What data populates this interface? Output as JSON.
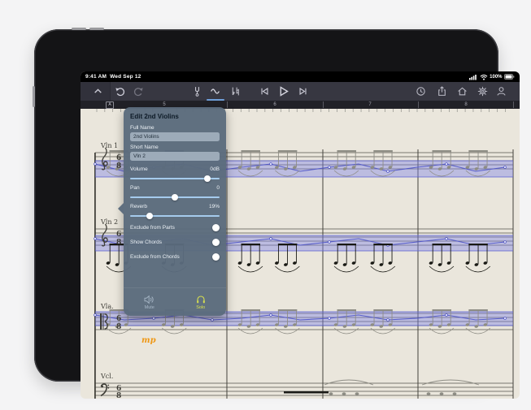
{
  "status_bar": {
    "time": "9:41 AM",
    "date": "Wed Sep 12",
    "battery_percent": "100%",
    "right_icons": [
      "signal-bars-icon",
      "wifi-icon",
      "battery-icon"
    ]
  },
  "toolbar": {
    "left_icons": [
      "chevron-up-icon",
      "undo-icon",
      "redo-icon"
    ],
    "tool_icons": [
      "tuning-fork-icon",
      "slur-tool-icon",
      "accidentals-icon"
    ],
    "active_tool": "slur-tool-icon",
    "transport_icons": [
      "skip-back-icon",
      "play-icon",
      "skip-forward-icon"
    ],
    "right_icons": [
      "history-clock-icon",
      "share-icon",
      "home-icon",
      "settings-gear-icon",
      "account-person-icon"
    ]
  },
  "ruler": {
    "section_marker": "A",
    "measure_numbers": [
      "5",
      "6",
      "7",
      "8"
    ]
  },
  "score": {
    "time_sig_top": "6",
    "time_sig_bottom": "8",
    "staves": [
      {
        "label": "Vln 1"
      },
      {
        "label": "Vln 2"
      },
      {
        "label": "Vla."
      },
      {
        "label": "Vcl."
      }
    ],
    "dynamic_marking": "mp",
    "selection_color": "#7c84e4"
  },
  "popup": {
    "title": "Edit 2nd Violins",
    "full_name_label": "Full Name",
    "full_name_value": "2nd Violins",
    "short_name_label": "Short Name",
    "short_name_value": "Vln 2",
    "sliders": [
      {
        "label": "Volume",
        "value": "0dB",
        "percent": 86
      },
      {
        "label": "Pan",
        "value": "0",
        "percent": 50
      },
      {
        "label": "Reverb",
        "value": "19%",
        "percent": 22
      }
    ],
    "toggles": [
      {
        "label": "Exclude from Parts"
      },
      {
        "label": "Show Chords"
      },
      {
        "label": "Exclude from Chords"
      }
    ],
    "mute_label": "Mute",
    "solo_label": "Solo",
    "solo_color": "#d8e04e"
  }
}
